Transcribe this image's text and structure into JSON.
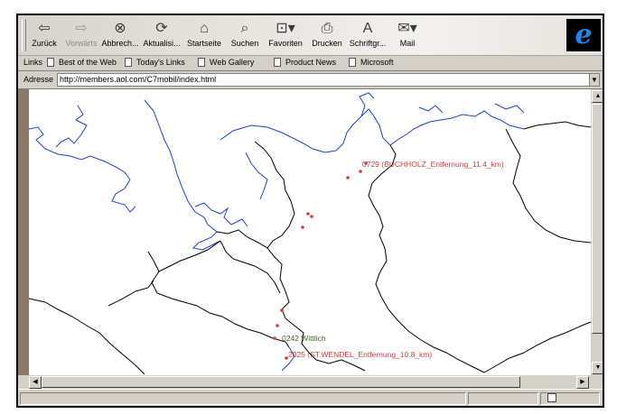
{
  "toolbar": {
    "buttons": [
      {
        "label": "Zurück",
        "icon": "back-arrow-icon"
      },
      {
        "label": "Vorwärts",
        "icon": "forward-arrow-icon"
      },
      {
        "label": "Abbrech...",
        "icon": "stop-icon"
      },
      {
        "label": "Aktualisi...",
        "icon": "refresh-icon"
      },
      {
        "label": "Startseite",
        "icon": "home-icon"
      },
      {
        "label": "Suchen",
        "icon": "search-icon"
      },
      {
        "label": "Favoriten",
        "icon": "favorites-icon"
      },
      {
        "label": "Drucken",
        "icon": "print-icon"
      },
      {
        "label": "Schriftgr...",
        "icon": "font-size-icon"
      },
      {
        "label": "Mail",
        "icon": "mail-icon"
      }
    ]
  },
  "links": {
    "label": "Links",
    "items": [
      "Best of the Web",
      "Today's Links",
      "Web Gallery",
      "Product News",
      "Microsoft"
    ]
  },
  "address": {
    "label": "Adresse",
    "value": "http://members.aol.com/C7mobil/index.html"
  },
  "map": {
    "labels": {
      "buchholz": "0729 (BUCHHOLZ_Entfernung_11.4_km)",
      "wittlich": "0242 Wittlich",
      "stwendel": "2025 (ST.WENDEL_Entfernung_10.8_km)"
    },
    "colors": {
      "coast": "#1f3fd0",
      "border": "#000000",
      "marker": "#d43a3a",
      "label_red": "#c94040",
      "label_green": "#4a5e3a"
    }
  }
}
